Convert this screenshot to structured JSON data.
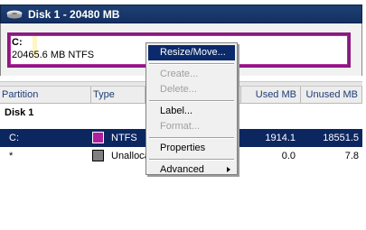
{
  "disk": {
    "title": "Disk 1 - 20480 MB",
    "icon": "hard-disk-icon"
  },
  "map": {
    "drive_letter": "C:",
    "size_fs": "20465.6 MB  NTFS",
    "partition_color": "#8b1a7f"
  },
  "columns": {
    "partition": "Partition",
    "type": "Type",
    "used": "Used MB",
    "unused": "Unused MB"
  },
  "group": "Disk 1",
  "rows": [
    {
      "partition": "C:",
      "type": "NTFS",
      "swatch_color": "#b01f9f",
      "used": "1914.1",
      "unused": "18551.5"
    },
    {
      "partition": "*",
      "type": "Unalloca",
      "swatch_color": "#808080",
      "used": "0.0",
      "unused": "7.8"
    }
  ],
  "context_menu": {
    "items": [
      {
        "label": "Resize/Move...",
        "enabled": true,
        "highlighted": true
      },
      {
        "label": "Create...",
        "enabled": false
      },
      {
        "label": "Delete...",
        "enabled": false
      },
      {
        "label": "Label...",
        "enabled": true
      },
      {
        "label": "Format...",
        "enabled": false
      },
      {
        "label": "Properties",
        "enabled": true
      },
      {
        "label": "Advanced",
        "enabled": true,
        "submenu": true
      }
    ]
  }
}
